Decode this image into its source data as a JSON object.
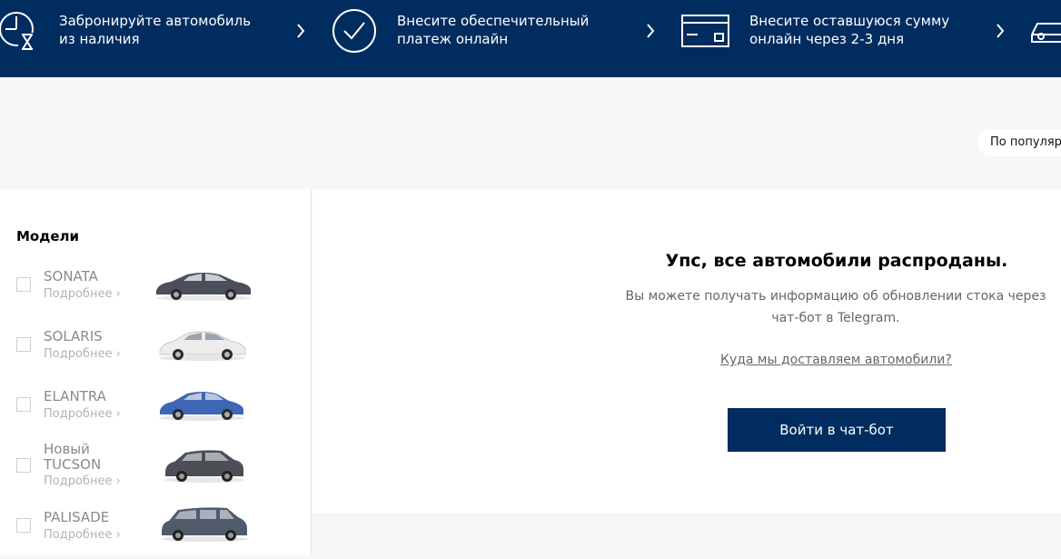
{
  "steps": [
    {
      "label": "Забронируйте автомобиль из наличия",
      "line1": "Забронируйте автомобиль",
      "line2": "из наличия",
      "icon": "clock-icon"
    },
    {
      "label": "Внесите обеспечительный платеж онлайн",
      "line1": "Внесите обеспечительный",
      "line2": "платеж онлайн",
      "icon": "check-circle-icon"
    },
    {
      "label": "Внесите оставшуюся сумму онлайн через 2-3 дня",
      "line1": "Внесите оставшуюся сумму",
      "line2": "онлайн через 2-3 дня",
      "icon": "credit-card-icon"
    },
    {
      "label": "",
      "icon": "car-icon"
    }
  ],
  "sort": {
    "label": "По популярн"
  },
  "filters": {
    "title": "Модели",
    "models": [
      {
        "name": "SONATA",
        "more": "Подробнее",
        "color": "#4a4f59"
      },
      {
        "name": "SOLARIS",
        "more": "Подробнее",
        "color": "#e9e9e9"
      },
      {
        "name": "ELANTRA",
        "more": "Подробнее",
        "color": "#3f66b5"
      },
      {
        "name_line1": "Новый",
        "name_line2": "TUCSON",
        "more": "Подробнее",
        "color": "#4c4f55"
      },
      {
        "name": "PALISADE",
        "more": "Подробнее",
        "color": "#4f5a6a"
      }
    ]
  },
  "empty": {
    "title": "Упс, все автомобили распроданы.",
    "text_line1": "Вы можете получать информацию об обновлении стока через",
    "text_line2": "чат-бот в Telegram.",
    "delivery_link": "Куда мы доставляем автомобили?",
    "cta_label": "Войти в чат-бот"
  },
  "colors": {
    "brand": "#002c5f",
    "background": "#f6f6f6"
  }
}
